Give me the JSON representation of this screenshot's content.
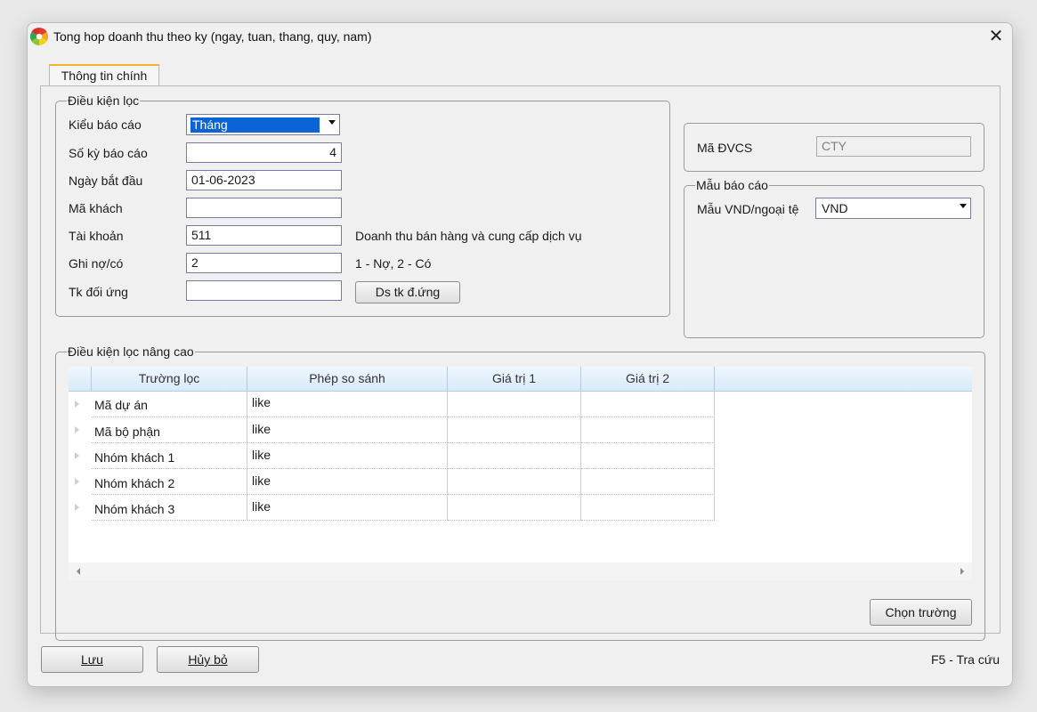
{
  "window": {
    "title": "Tong hop doanh thu theo ky (ngay, tuan, thang, quy, nam)",
    "close": "✕"
  },
  "tab": {
    "label": "Thông tin chính"
  },
  "filter": {
    "legend": "Điều kiện lọc",
    "report_type": {
      "label": "Kiểu báo cáo",
      "value": "Tháng"
    },
    "periods": {
      "label": "Số kỳ báo cáo",
      "value": "4"
    },
    "start_date": {
      "label": "Ngày bắt đầu",
      "value": "01-06-2023"
    },
    "customer": {
      "label": "Mã khách",
      "value": ""
    },
    "account": {
      "label": "Tài khoản",
      "value": "511",
      "desc": "Doanh thu bán hàng và cung cấp dịch vụ"
    },
    "debit_credit": {
      "label": "Ghi nợ/có",
      "value": "2",
      "desc": "1 - Nợ, 2 - Có"
    },
    "contra_account": {
      "label": "Tk đối ứng",
      "value": "",
      "button": "Ds tk đ.ứng"
    }
  },
  "unit": {
    "label": "Mã ĐVCS",
    "value": "CTY"
  },
  "template": {
    "legend": "Mẫu báo cáo",
    "label": "Mẫu VND/ngoại tệ",
    "value": "VND"
  },
  "advanced": {
    "legend": "Điều kiện lọc nâng cao",
    "columns": [
      "Trường lọc",
      "Phép so sánh",
      "Giá trị 1",
      "Giá trị 2"
    ],
    "rows": [
      {
        "field": "Mã dự án",
        "op": "like",
        "v1": "",
        "v2": ""
      },
      {
        "field": "Mã bộ phận",
        "op": "like",
        "v1": "",
        "v2": ""
      },
      {
        "field": "Nhóm khách 1",
        "op": "like",
        "v1": "",
        "v2": ""
      },
      {
        "field": "Nhóm khách 2",
        "op": "like",
        "v1": "",
        "v2": ""
      },
      {
        "field": "Nhóm khách 3",
        "op": "like",
        "v1": "",
        "v2": ""
      }
    ],
    "choose_button": "Chọn trường"
  },
  "footer": {
    "save": "Lưu",
    "cancel": "Hủy bỏ",
    "hint": "F5 - Tra cứu"
  },
  "colors": {
    "accent_tab": "#f2b530",
    "selection": "#0a64d8",
    "grid_header": "#d8eaf9"
  },
  "icons": {
    "app": "app-logo-icon",
    "close": "close-icon",
    "dropdown": "chevron-down-icon"
  }
}
